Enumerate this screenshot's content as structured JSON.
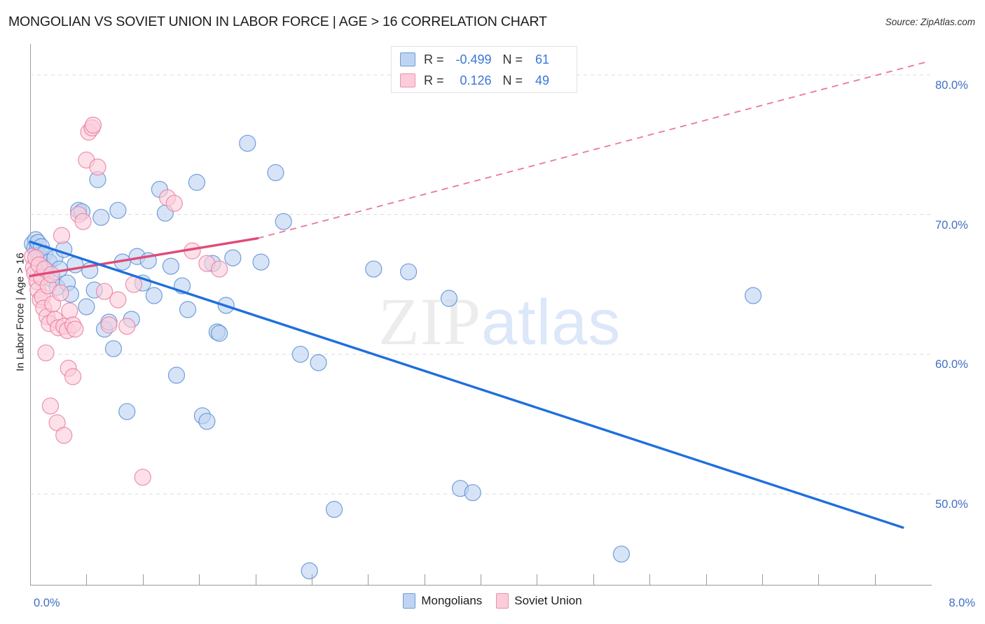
{
  "header": {
    "title": "MONGOLIAN VS SOVIET UNION IN LABOR FORCE | AGE > 16 CORRELATION CHART",
    "source": "Source: ZipAtlas.com"
  },
  "watermark": {
    "part1": "ZIP",
    "part2": "atlas"
  },
  "stats": {
    "row1": {
      "r_label": "R =",
      "r_value": "-0.499",
      "n_label": "N =",
      "n_value": "61",
      "color": "#bed4f2"
    },
    "row2": {
      "r_label": "R =",
      "r_value": "0.126",
      "n_label": "N =",
      "n_value": "49",
      "color": "#fbcdda"
    }
  },
  "legend": {
    "items": [
      {
        "label": "Mongolians",
        "color": "#bed4f2"
      },
      {
        "label": "Soviet Union",
        "color": "#fbcdda"
      }
    ]
  },
  "axes": {
    "y_title": "In Labor Force | Age > 16",
    "y_ticks": [
      "80.0%",
      "70.0%",
      "60.0%",
      "50.0%"
    ],
    "x_min_label": "0.0%",
    "x_max_label": "8.0%"
  },
  "chart_data": {
    "type": "scatter",
    "title": "MONGOLIAN VS SOVIET UNION IN LABOR FORCE | AGE > 16 CORRELATION CHART",
    "xlabel": "",
    "ylabel": "In Labor Force | Age > 16",
    "xlim": [
      0.0,
      8.0
    ],
    "ylim": [
      43.5,
      82.2
    ],
    "x_unit": "%",
    "y_unit": "%",
    "grid": true,
    "y_gridlines": [
      80.0,
      70.0,
      60.0,
      50.0
    ],
    "legend_position": "bottom-center",
    "series": [
      {
        "name": "Mongolians",
        "color": "#bed4f2",
        "edge_color": "#5b8fd4",
        "r": -0.499,
        "n": 61,
        "trend": {
          "x0": 0.0,
          "y0": 68.05,
          "x1": 7.75,
          "y1": 47.6,
          "style": "solid",
          "color": "#1f6fdd"
        },
        "points": [
          [
            0.02,
            67.9
          ],
          [
            0.04,
            67.6
          ],
          [
            0.05,
            68.2
          ],
          [
            0.06,
            67.4
          ],
          [
            0.07,
            68.0
          ],
          [
            0.08,
            67.1
          ],
          [
            0.09,
            66.8
          ],
          [
            0.1,
            67.7
          ],
          [
            0.11,
            66.3
          ],
          [
            0.13,
            67.2
          ],
          [
            0.15,
            65.9
          ],
          [
            0.17,
            66.6
          ],
          [
            0.19,
            65.4
          ],
          [
            0.22,
            66.9
          ],
          [
            0.24,
            64.8
          ],
          [
            0.26,
            66.1
          ],
          [
            0.3,
            67.5
          ],
          [
            0.33,
            65.1
          ],
          [
            0.36,
            64.3
          ],
          [
            0.4,
            66.4
          ],
          [
            0.43,
            70.3
          ],
          [
            0.46,
            70.2
          ],
          [
            0.5,
            63.4
          ],
          [
            0.53,
            66.0
          ],
          [
            0.57,
            64.6
          ],
          [
            0.6,
            72.5
          ],
          [
            0.63,
            69.8
          ],
          [
            0.66,
            61.8
          ],
          [
            0.7,
            62.3
          ],
          [
            0.74,
            60.4
          ],
          [
            0.78,
            70.3
          ],
          [
            0.82,
            66.6
          ],
          [
            0.86,
            55.9
          ],
          [
            0.9,
            62.5
          ],
          [
            0.95,
            67.0
          ],
          [
            1.0,
            65.1
          ],
          [
            1.05,
            66.7
          ],
          [
            1.1,
            64.2
          ],
          [
            1.15,
            71.8
          ],
          [
            1.2,
            70.1
          ],
          [
            1.25,
            66.3
          ],
          [
            1.3,
            58.5
          ],
          [
            1.35,
            64.9
          ],
          [
            1.4,
            63.2
          ],
          [
            1.48,
            72.3
          ],
          [
            1.53,
            55.6
          ],
          [
            1.57,
            55.2
          ],
          [
            1.62,
            66.5
          ],
          [
            1.66,
            61.6
          ],
          [
            1.68,
            61.5
          ],
          [
            1.74,
            63.5
          ],
          [
            1.8,
            66.9
          ],
          [
            1.93,
            75.1
          ],
          [
            2.05,
            66.6
          ],
          [
            2.18,
            73.0
          ],
          [
            2.25,
            69.5
          ],
          [
            2.4,
            60.0
          ],
          [
            2.56,
            59.4
          ],
          [
            2.7,
            48.9
          ],
          [
            3.05,
            66.1
          ],
          [
            3.36,
            65.9
          ],
          [
            3.72,
            64.0
          ],
          [
            3.82,
            50.4
          ],
          [
            3.93,
            50.1
          ],
          [
            5.25,
            45.7
          ],
          [
            6.42,
            64.2
          ],
          [
            2.48,
            44.5
          ]
        ]
      },
      {
        "name": "Soviet Union",
        "color": "#fbcdda",
        "edge_color": "#e87fa2",
        "r": 0.126,
        "n": 49,
        "trend": {
          "x0": 0.0,
          "y0": 65.6,
          "x1": 2.02,
          "y1": 68.3,
          "style": "solid",
          "color": "#e04b79",
          "dash_x0": 2.02,
          "dash_y0": 68.3,
          "dash_x1": 7.95,
          "dash_y1": 80.9
        },
        "points": [
          [
            0.02,
            67.0
          ],
          [
            0.03,
            66.2
          ],
          [
            0.04,
            65.8
          ],
          [
            0.05,
            66.9
          ],
          [
            0.06,
            65.2
          ],
          [
            0.07,
            64.6
          ],
          [
            0.08,
            66.4
          ],
          [
            0.09,
            63.9
          ],
          [
            0.1,
            65.5
          ],
          [
            0.11,
            64.1
          ],
          [
            0.12,
            63.3
          ],
          [
            0.13,
            66.1
          ],
          [
            0.15,
            62.7
          ],
          [
            0.16,
            64.9
          ],
          [
            0.17,
            62.2
          ],
          [
            0.19,
            65.7
          ],
          [
            0.2,
            63.6
          ],
          [
            0.22,
            62.5
          ],
          [
            0.25,
            61.9
          ],
          [
            0.27,
            64.4
          ],
          [
            0.28,
            68.5
          ],
          [
            0.3,
            62.0
          ],
          [
            0.33,
            61.7
          ],
          [
            0.35,
            63.1
          ],
          [
            0.38,
            62.1
          ],
          [
            0.4,
            61.8
          ],
          [
            0.14,
            60.1
          ],
          [
            0.18,
            56.3
          ],
          [
            0.24,
            55.1
          ],
          [
            0.3,
            54.2
          ],
          [
            0.34,
            59.0
          ],
          [
            0.38,
            58.4
          ],
          [
            0.43,
            70.0
          ],
          [
            0.47,
            69.5
          ],
          [
            0.52,
            75.9
          ],
          [
            0.55,
            76.2
          ],
          [
            0.56,
            76.4
          ],
          [
            0.5,
            73.9
          ],
          [
            0.6,
            73.4
          ],
          [
            0.66,
            64.5
          ],
          [
            0.7,
            62.1
          ],
          [
            0.78,
            63.9
          ],
          [
            0.86,
            62.0
          ],
          [
            0.92,
            65.0
          ],
          [
            1.0,
            51.2
          ],
          [
            1.22,
            71.2
          ],
          [
            1.28,
            70.8
          ],
          [
            1.44,
            67.4
          ],
          [
            1.57,
            66.5
          ],
          [
            1.68,
            66.1
          ]
        ]
      }
    ]
  }
}
